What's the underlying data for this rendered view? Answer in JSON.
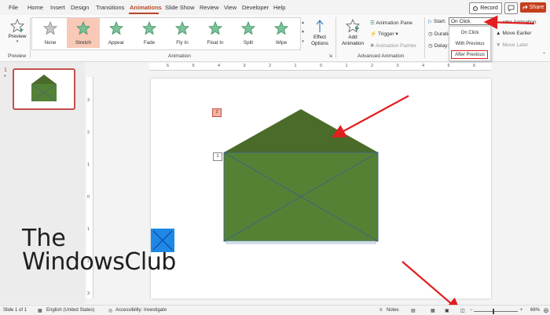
{
  "menu": {
    "tabs": [
      {
        "label": "File"
      },
      {
        "label": "Home"
      },
      {
        "label": "Insert"
      },
      {
        "label": "Design"
      },
      {
        "label": "Transitions"
      },
      {
        "label": "Animations"
      },
      {
        "label": "Slide Show"
      },
      {
        "label": "Review"
      },
      {
        "label": "View"
      },
      {
        "label": "Developer"
      },
      {
        "label": "Help"
      }
    ],
    "active_tab": "Animations",
    "record_label": "Record",
    "share_label": "Share"
  },
  "ribbon": {
    "preview": {
      "button_label": "Preview",
      "group_label": "Preview"
    },
    "animation_gallery": [
      {
        "label": "None",
        "icon": "star-outline-icon"
      },
      {
        "label": "Stretch",
        "icon": "star-stretch-icon",
        "selected": true
      },
      {
        "label": "Appear",
        "icon": "star-appear-icon"
      },
      {
        "label": "Fade",
        "icon": "star-fade-icon"
      },
      {
        "label": "Fly In",
        "icon": "star-fly-in-icon"
      },
      {
        "label": "Float In",
        "icon": "star-float-in-icon"
      },
      {
        "label": "Split",
        "icon": "star-split-icon"
      },
      {
        "label": "Wipe",
        "icon": "star-wipe-icon"
      }
    ],
    "effect_options": {
      "line1": "Effect",
      "line2": "Options"
    },
    "animation_group_label": "Animation",
    "add_animation": {
      "line1": "Add",
      "line2": "Animation"
    },
    "animation_pane": "Animation Pane",
    "trigger": "Trigger",
    "animation_painter": "Animation Painter",
    "advanced_group_label": "Advanced Animation",
    "timing": {
      "start_label": "Start:",
      "start_value": "On Click",
      "duration_label": "Duratio",
      "delay_label": "Delay:",
      "reorder_label": "rder Animation",
      "move_earlier": "Move Earlier",
      "move_later": "Move Later"
    },
    "start_options": [
      {
        "label": "On Click"
      },
      {
        "label": "With Previous"
      },
      {
        "label": "After Previous"
      }
    ]
  },
  "slide_panel": {
    "number": "1",
    "star": "*"
  },
  "ruler": {
    "top": [
      "6",
      "5",
      "4",
      "3",
      "2",
      "1",
      "0",
      "1",
      "2",
      "3",
      "4",
      "5",
      "6"
    ],
    "left": [
      "3",
      "2",
      "1",
      "0",
      "1",
      "2",
      "3"
    ]
  },
  "slide": {
    "tag_top": "2",
    "tag_bottom": "1",
    "envelope_colors": {
      "flap": "#4a6b2a",
      "body": "#548235",
      "outline": "#3f5f86"
    }
  },
  "watermark": {
    "line1": "The",
    "line2": "WindowsClub"
  },
  "status": {
    "slide_info": "Slide 1 of 1",
    "language": "English (United States)",
    "accessibility": "Accessibility: Investigate",
    "notes": "Notes",
    "zoom": "66%"
  },
  "colors": {
    "accent": "#b7472a",
    "share": "#c43e1c",
    "annotation_red": "#e21e1e"
  }
}
